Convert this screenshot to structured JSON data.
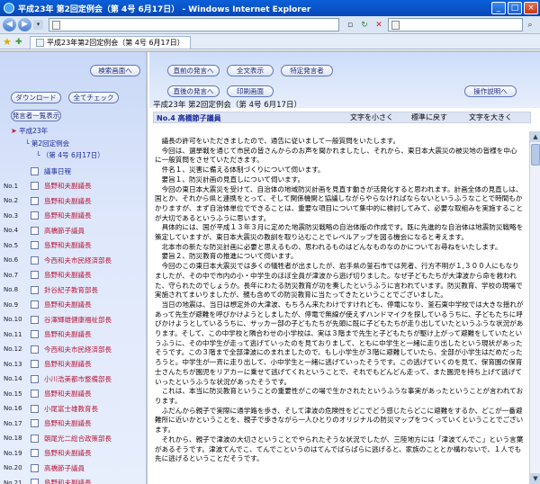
{
  "window": {
    "title": "平成23年 第2回定例会（第 4号 6月17日） - Windows Internet Explorer"
  },
  "browser": {
    "tab_title": "平成23年第2回定例会（第 4号 6月17日）"
  },
  "left_pane": {
    "buttons": {
      "search_screen": "検索画面へ",
      "download": "ダウンロード",
      "check_all": "全てチェック",
      "show_speakers": "発言者一覧表示"
    },
    "tree": {
      "year": "平成23年",
      "session": "第2回定例会",
      "meeting": "（第 4号 6月17日）"
    },
    "items": [
      {
        "no": "",
        "label": "議事日程",
        "color": "blue"
      },
      {
        "no": "No.1",
        "label": "島野和夫副議長",
        "color": "red"
      },
      {
        "no": "No.2",
        "label": "島野和夫副議長",
        "color": "red"
      },
      {
        "no": "No.3",
        "label": "島野和夫副議長",
        "color": "red"
      },
      {
        "no": "No.4",
        "label": "高橋節子議員",
        "color": "red"
      },
      {
        "no": "No.5",
        "label": "島野和夫副議長",
        "color": "red"
      },
      {
        "no": "No.6",
        "label": "今西和夫市民経済部長",
        "color": "red"
      },
      {
        "no": "No.7",
        "label": "島野和夫副議長",
        "color": "red"
      },
      {
        "no": "No.8",
        "label": "針谷紀子教育部長",
        "color": "red"
      },
      {
        "no": "No.9",
        "label": "島野和夫副議長",
        "color": "red"
      },
      {
        "no": "No.10",
        "label": "谷澤輝雄健康福祉部長",
        "color": "red"
      },
      {
        "no": "No.11",
        "label": "島野和夫副議長",
        "color": "red"
      },
      {
        "no": "No.12",
        "label": "今西和夫市民経済部長",
        "color": "red"
      },
      {
        "no": "No.13",
        "label": "島野和夫副議長",
        "color": "red"
      },
      {
        "no": "No.14",
        "label": "小川浩美都市整備部長",
        "color": "red"
      },
      {
        "no": "No.15",
        "label": "島野和夫副議長",
        "color": "red"
      },
      {
        "no": "No.16",
        "label": "小尾富士雄教育長",
        "color": "red"
      },
      {
        "no": "No.17",
        "label": "島野和夫副議長",
        "color": "red"
      },
      {
        "no": "No.18",
        "label": "朝尾光二総合政策部長",
        "color": "red"
      },
      {
        "no": "No.19",
        "label": "島野和夫副議長",
        "color": "red"
      },
      {
        "no": "No.20",
        "label": "高橋節子議員",
        "color": "red"
      },
      {
        "no": "No.21",
        "label": "島野和夫副議長",
        "color": "red"
      }
    ]
  },
  "right_pane": {
    "buttons": {
      "prev_speech": "直前の発言へ",
      "show_all": "全文表示",
      "specific_speaker": "特定発言者",
      "next_speech": "直後の発言へ",
      "print_screen": "印刷画面",
      "instructions": "操作説明へ"
    },
    "meeting_title": "平成23年 第2回定例会（第 4号 6月17日）",
    "speaker": "No.4 高橋節子議員",
    "font_controls": {
      "smaller": "文字を小さく",
      "reset": "標準に戻す",
      "larger": "文字を大きく"
    },
    "paragraphs": [
      "議長の許可をいただきましたので、通告に従いまして一般質問をいたします。",
      "今回は、選挙戦を通じて市民の皆さんからのお声を聞かれましたし、それから、東日本大震災の被災地の皆様を中心に一般質問をさせていただきます。",
      "件名１、災害に備える体制づくりについて伺います。",
      "要旨１、防災計画の見直しについて伺います。",
      "今回の東日本大震災を受けて、自治体の地域防災計画を見直す動きが活発化すると思われます。計画全体の見直しは、国とか、それから県と連携をとって、そして関係機関と協議しながらやらなければならないというふうなことで時間もかかりますが、まず自治体単位でできることは、重要な項目について集中的に検討してみて、必要な取組みを実施することが大切であるというふうに思います。",
      "具体的には、国が平成１３年３月に定めた地震防災戦略の自治体版の作成です。既に先進的な自治体は地震防災戦略を策定していますが、東日本大震災の教訓を取り込むことでレベルアップを図る機会になると考えます。",
      "北本市の新たな防災計画に必要と思えるもの、思われるものはどんなものなのかについてお尋ねをいたします。",
      "要旨２、防災教育の推進について伺います。",
      "今回のこの東日本大震災では多くの犠牲者が出ましたが、岩手県の釜石市では死者、行方不明が１,３００人にもなりましたが、その中で市内の小・中学生のほぼ全員が津波から逃げ切りました。なぜ子どもたちが大津波から命を救われた、守られたのでしょうか。長年にわたる防災教育が功を奏したというふうに言われています。防災教育、学校の現場で実施されてまいりましたが、親も含めての防災教育に当たってきたということでございました。",
      "当日の地震は、当日は想定外の大津波、もちろん来たわけですけれども、停電になり、釜石東中学校では大きな揺れがあって先生が避難を呼びかけようとしましたが、停電で無線が使えずハンドマイクを探しているうちに、子どもたちに呼びかけようとしているうちに、サッカー部の子どもたちが先頭に既に子どもたちが走り出していたというふうな状況があります。そして、この中学校と隣合わせの小学校は、実は３階まで先生と子どもたちが駆け上がって避難をしていたというふうに、その中学生が走って逃げていったのを見ておりまして、ともに中学生と一緒に走り出したという現状があったそうです。この３階まで全部津波にのまれましたので、もし小学生が３階に避難していたら、全部が小学生はだめだったろうと。中学生が一斉に走り出して、小中学生と一緒に逃げていったそうです。この逃げていくのを見て、保育園の保育士さんたちが園児をリアカーに乗せて逃げてくれということで、それでもどんどん走って、また園児を持ち上げて逃げていったというふうな状況があったそうです。",
      "これは、本当に防災教育ということの重要性がこの場で生かされたというふうな事実があったということが言われております。",
      "ふだんから親子で実際に通学路を歩き、そして津波の危険性をどこでどう感じたらどこに避難をするか、どこが一番避難所に近いかということを、親子で歩きながら一人ひとりのオリジナルの防災マップをつくっていくということでございます。",
      "それから、親子で津波の大切さということでやられたそうな状況でしたが、三陸地方には「津波てんでこ」という言葉があるそうです。津波てんでこ、てんでこというのはてんでばらばらに逃げると、家族のこととか構わないで、１人でも先に逃げるということだそうです。"
    ]
  }
}
